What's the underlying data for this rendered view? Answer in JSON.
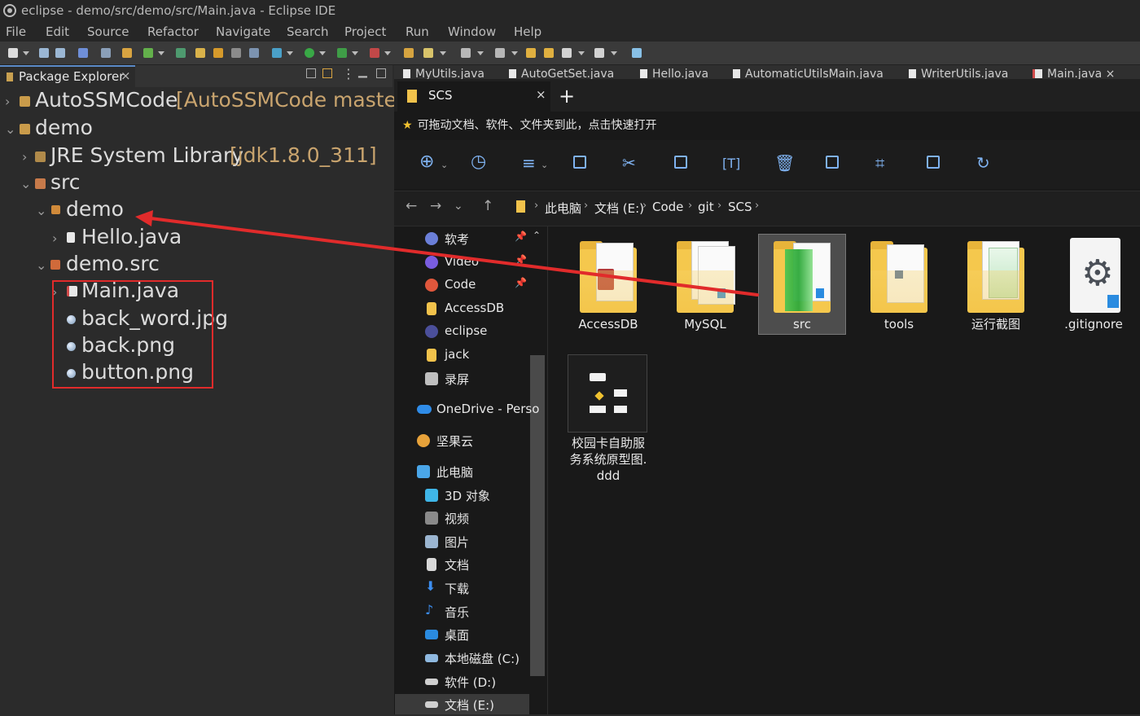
{
  "window": {
    "title": "eclipse - demo/src/demo/src/Main.java - Eclipse IDE"
  },
  "menu": [
    "File",
    "Edit",
    "Source",
    "Refactor",
    "Navigate",
    "Search",
    "Project",
    "Run",
    "Window",
    "Help"
  ],
  "package_explorer": {
    "tab_label": "Package Explorer",
    "tree": {
      "project1": {
        "name": "AutoSSMCode",
        "decoration": "[AutoSSMCode master]"
      },
      "project2": {
        "name": "demo"
      },
      "jre": {
        "name": "JRE System Library",
        "decoration": "[jdk1.8.0_311]"
      },
      "src": {
        "name": "src"
      },
      "pkg_demo": {
        "name": "demo"
      },
      "hello": {
        "name": "Hello.java"
      },
      "pkg_demo_src": {
        "name": "demo.src"
      },
      "main": {
        "name": "Main.java"
      },
      "file1": {
        "name": "back_word.jpg"
      },
      "file2": {
        "name": "back.png"
      },
      "file3": {
        "name": "button.png"
      }
    }
  },
  "editor_tabs": [
    "MyUtils.java",
    "AutoGetSet.java",
    "Hello.java",
    "AutomaticUtilsMain.java",
    "WriterUtils.java",
    "Main.java"
  ],
  "explorer": {
    "tab_title": "SCS",
    "hint": "可拖动文档、软件、文件夹到此，点击快速打开",
    "breadcrumb": [
      "此电脑",
      "文档 (E:)",
      "Code",
      "git",
      "SCS"
    ],
    "nav": {
      "ruankao": "软考",
      "video": "Video",
      "code": "Code",
      "accessdb": "AccessDB",
      "eclipse": "eclipse",
      "jack": "jack",
      "luping": "录屏",
      "onedrive": "OneDrive - Perso",
      "jianguoyun": "坚果云",
      "thispc": "此电脑",
      "obj3d": "3D 对象",
      "videos": "视频",
      "pictures": "图片",
      "documents": "文档",
      "downloads": "下载",
      "music": "音乐",
      "desktop": "桌面",
      "drive_c": "本地磁盘 (C:)",
      "drive_d": "软件 (D:)",
      "drive_e": "文档 (E:)"
    },
    "files": {
      "f1": "AccessDB",
      "f2": "MySQL",
      "f3": "src",
      "f4": "tools",
      "f5": "运行截图",
      "f6": ".gitignore",
      "f7": "校园卡自助服务系统原型图.ddd"
    }
  },
  "colors": {
    "annotation_red": "#e12b2b",
    "folder_yellow": "#f5c84d",
    "accent_blue": "#7fb2f0"
  }
}
